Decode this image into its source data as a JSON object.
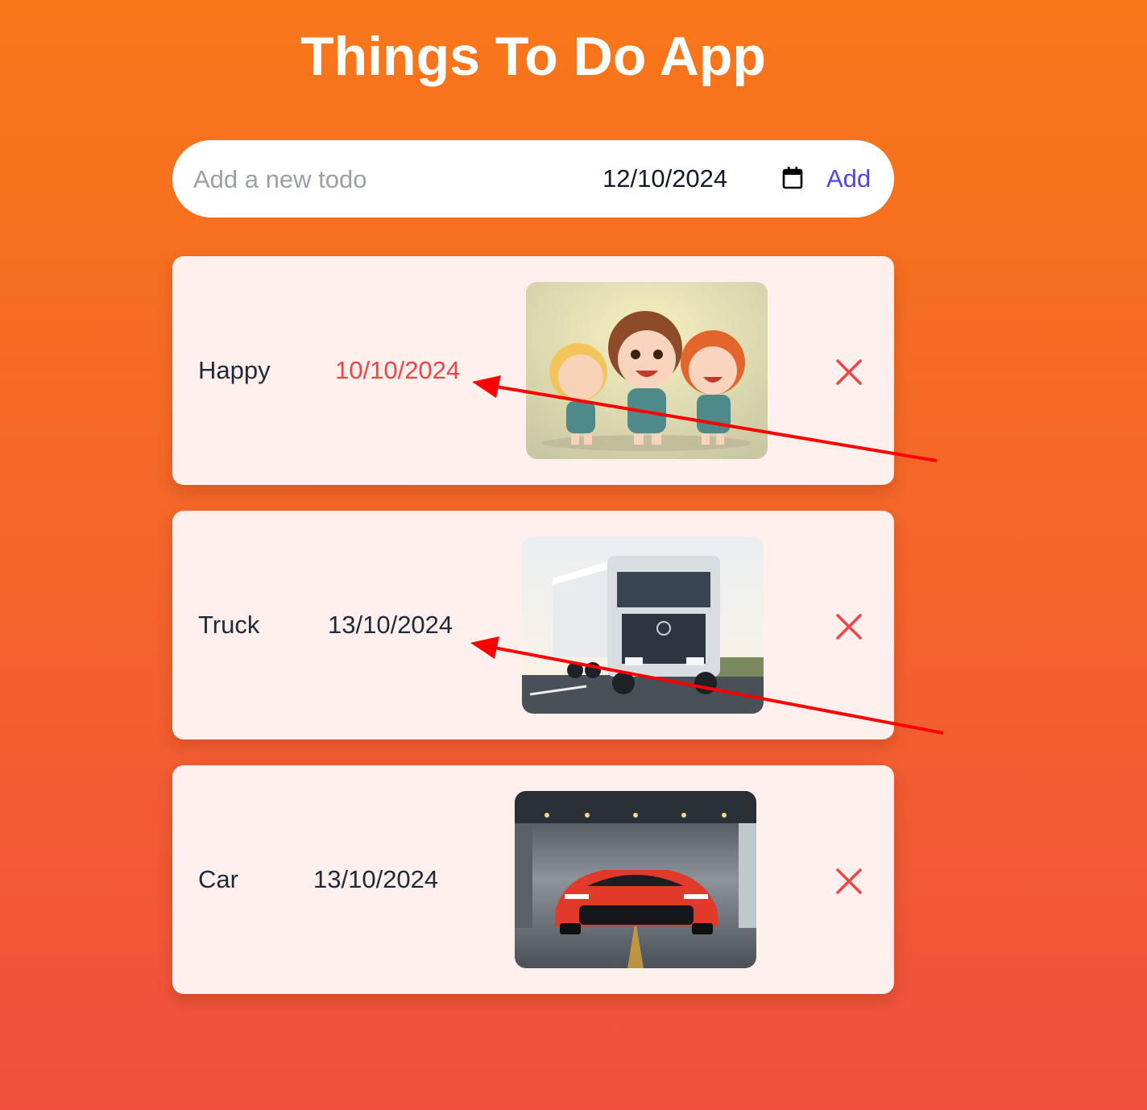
{
  "app": {
    "title": "Things To Do App"
  },
  "add_form": {
    "placeholder": "Add a new todo",
    "value": "",
    "date_value": "12/10/2024",
    "add_label": "Add",
    "calendar_icon": "calendar-icon"
  },
  "todos": [
    {
      "text": "Happy",
      "date": "10/10/2024",
      "overdue": true,
      "image": "cartoon-kids-image",
      "delete_icon": "close-icon"
    },
    {
      "text": "Truck",
      "date": "13/10/2024",
      "overdue": false,
      "image": "truck-image",
      "delete_icon": "close-icon"
    },
    {
      "text": "Car",
      "date": "13/10/2024",
      "overdue": false,
      "image": "sports-car-image",
      "delete_icon": "close-icon"
    }
  ],
  "colors": {
    "accent": "#4f46e5",
    "overdue": "#ef4444",
    "annotation_arrow": "#ff0000",
    "card_bg": "#fff0ed",
    "bg_top": "#f97719",
    "bg_bottom": "#ef4f3c"
  }
}
